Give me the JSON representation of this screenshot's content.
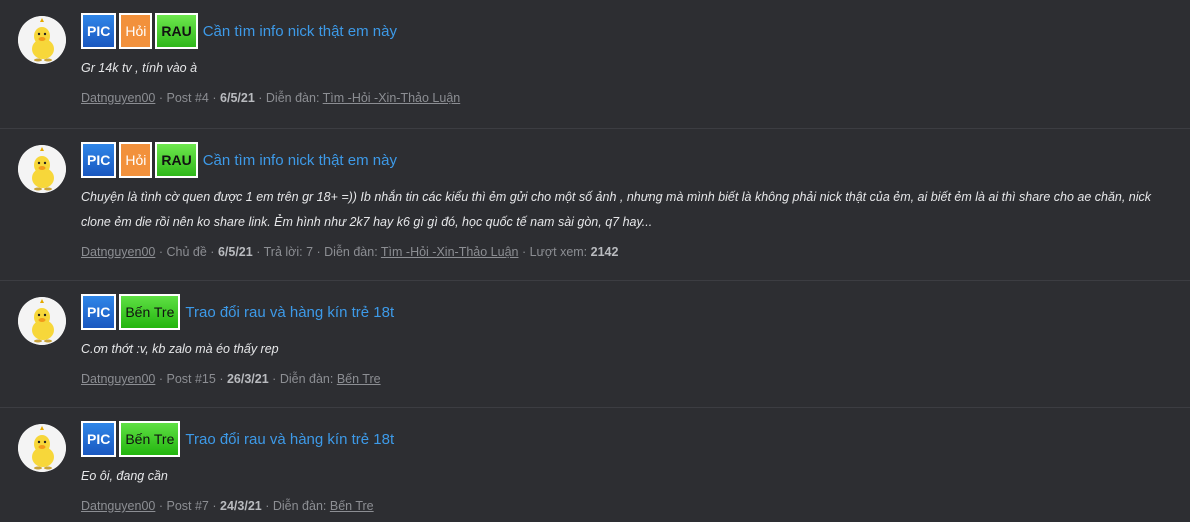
{
  "results": [
    {
      "badges": [
        {
          "kind": "pic",
          "label": "PIC"
        },
        {
          "kind": "hoi",
          "label": "Hỏi"
        },
        {
          "kind": "rau",
          "label": "RAU"
        }
      ],
      "title": "Cần tìm info nick thật em này",
      "snippet": "Gr 14k tv , tính vào à",
      "author": "Datnguyen00",
      "type_label": "Post #4",
      "date": "6/5/21",
      "forum_prefix": "Diễn đàn:",
      "forum": "Tìm -Hỏi -Xin-Thảo Luận"
    },
    {
      "badges": [
        {
          "kind": "pic",
          "label": "PIC"
        },
        {
          "kind": "hoi",
          "label": "Hỏi"
        },
        {
          "kind": "rau",
          "label": "RAU"
        }
      ],
      "title": "Cần tìm info nick thật em này",
      "snippet": "Chuyện là tình cờ quen được 1 em trên gr 18+ =)) Ib nhắn tin các kiểu thì ẻm gửi cho một số ảnh , nhưng mà mình biết là không phải nick thật của ẻm, ai biết ẻm là ai thì share cho ae chăn, nick clone ẻm die rồi nên ko share link. Ẻm hình như 2k7 hay k6 gì gì đó, học quốc tế nam sài gòn, q7 hay...",
      "author": "Datnguyen00",
      "type_label": "Chủ đề",
      "date": "6/5/21",
      "replies": "Trả lời: 7",
      "forum_prefix": "Diễn đàn:",
      "forum": "Tìm -Hỏi -Xin-Thảo Luận",
      "views_label": "Lượt xem:",
      "views": "2142"
    },
    {
      "badges": [
        {
          "kind": "pic",
          "label": "PIC"
        },
        {
          "kind": "bentre",
          "label": "Bến Tre"
        }
      ],
      "title": "Trao đổi rau và hàng kín trẻ 18t",
      "snippet": "C.ơn thớt :v, kb zalo mà éo thấy rep",
      "author": "Datnguyen00",
      "type_label": "Post #15",
      "date": "26/3/21",
      "forum_prefix": "Diễn đàn:",
      "forum": "Bến Tre"
    },
    {
      "badges": [
        {
          "kind": "pic",
          "label": "PIC"
        },
        {
          "kind": "bentre",
          "label": "Bến Tre"
        }
      ],
      "title": "Trao đổi rau và hàng kín trẻ 18t",
      "snippet": "Eo ôi, đang cần",
      "author": "Datnguyen00",
      "type_label": "Post #7",
      "date": "24/3/21",
      "forum_prefix": "Diễn đàn:",
      "forum": "Bến Tre"
    }
  ],
  "colors": {
    "background": "#2d2e32",
    "title_link": "#3d9ae8",
    "badge_pic": "#1a58c0",
    "badge_hoi": "#f2913c",
    "badge_rau": "#2fb71a"
  },
  "icons": {
    "avatar": "yellow-duck-avatar"
  }
}
